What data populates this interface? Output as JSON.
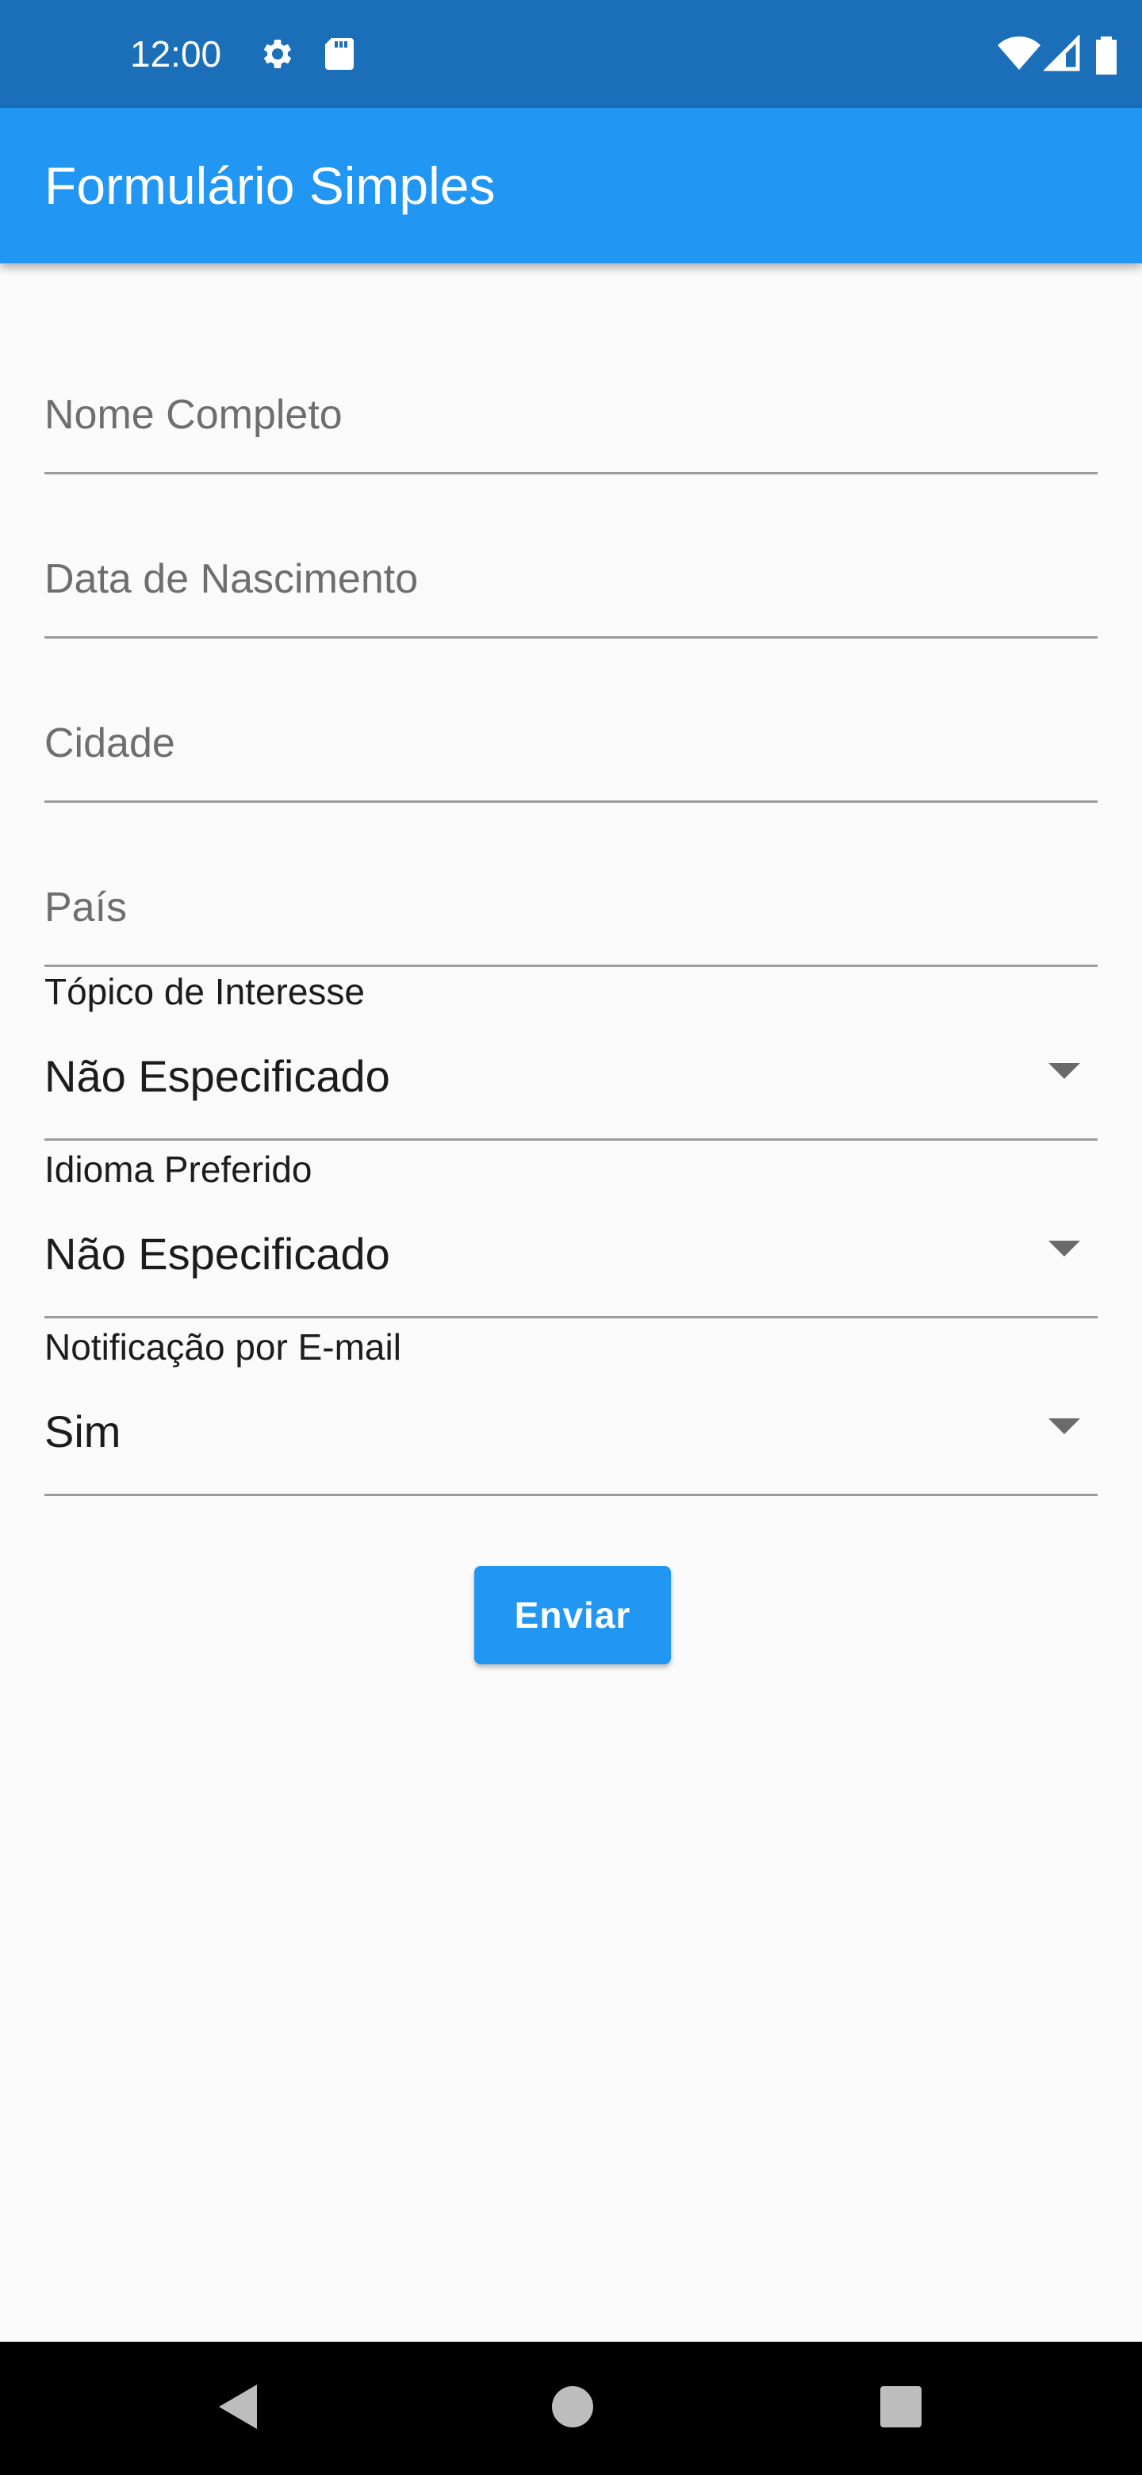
{
  "status_bar": {
    "time": "12:00",
    "icons": [
      "gear-icon",
      "sd-card-icon",
      "wifi-icon",
      "signal-icon",
      "battery-icon"
    ]
  },
  "app_bar": {
    "title": "Formulário Simples",
    "color": "#2196f3"
  },
  "form": {
    "fields": [
      {
        "placeholder": "Nome Completo",
        "value": ""
      },
      {
        "placeholder": "Data de Nascimento",
        "value": ""
      },
      {
        "placeholder": "Cidade",
        "value": ""
      },
      {
        "placeholder": "País",
        "value": ""
      }
    ],
    "dropdowns": [
      {
        "label": "Tópico de Interesse",
        "selected": "Não Especificado"
      },
      {
        "label": "Idioma Preferido",
        "selected": "Não Especificado"
      },
      {
        "label": "Notificação por E-mail",
        "selected": "Sim"
      }
    ],
    "submit_label": "Enviar"
  },
  "nav_bar": {
    "buttons": [
      "back-icon",
      "home-icon",
      "recents-icon"
    ]
  }
}
